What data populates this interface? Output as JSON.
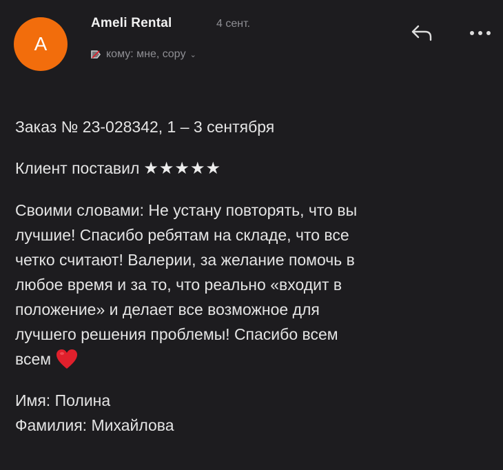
{
  "sender": {
    "avatar_letter": "A",
    "name": "Ameli Rental",
    "date": "4 сент.",
    "recipients": "кому: мне, copy"
  },
  "colors": {
    "background": "#1d1c1f",
    "avatar": "#f26d0c",
    "text": "#e4e4e4",
    "muted": "#8f8f94",
    "heart": "#e0202c"
  },
  "icons": {
    "reply": "reply-arrow",
    "more": "three-dots-horizontal",
    "label": "important-tag",
    "heart": "red-heart"
  },
  "message": {
    "order_line": "Заказ № 23-028342, 1 – 3 сентября",
    "rating_label": "Клиент поставил",
    "rating_stars": "★★★★★",
    "rating_value": 5,
    "review_lines": [
      "Своими словами: Не устану повторять, что вы",
      "лучшие! Спасибо ребятам на складе, что все",
      "четко считают! Валерии, за желание помочь в",
      "любое время и за то, что реально «входит в",
      "положение» и делает все возможное для",
      "лучшего решения проблемы! Спасибо всем",
      "всем"
    ],
    "first_name_line": "Имя: Полина",
    "last_name_line": "Фамилия: Михайлова"
  }
}
